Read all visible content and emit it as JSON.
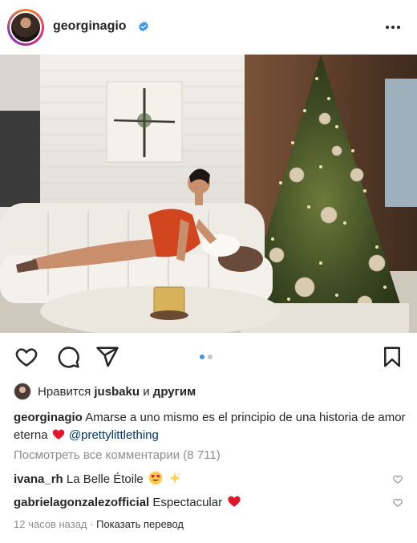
{
  "post": {
    "username": "georginagio",
    "verified_icon": "verified-badge-icon",
    "more_icon": "more-options-icon"
  },
  "actions": {
    "like_icon": "heart-outline-icon",
    "comment_icon": "comment-bubble-icon",
    "share_icon": "paper-plane-icon",
    "save_icon": "bookmark-icon",
    "carousel": {
      "total": 2,
      "active": 1
    }
  },
  "likes": {
    "prefix": "Нравится",
    "user": "jusbaku",
    "joiner": "и",
    "others": "другим"
  },
  "caption": {
    "username": "georginagio",
    "text": "Amarse a uno mismo es el principio de una historia de amor eterna",
    "emoji": "red-heart",
    "mention": "@prettylittlething"
  },
  "view_comments": "Посмотреть все комментарии (8 711)",
  "comments": [
    {
      "username": "ivana_rh",
      "text": "La Belle Étoile",
      "emojis": [
        "heart-eyes",
        "sparkle-star"
      ]
    },
    {
      "username": "gabrielagonzalezofficial",
      "text": "Espectacular",
      "emojis": [
        "red-heart"
      ]
    }
  ],
  "footer": {
    "time": "12 часов назад",
    "separator": "·",
    "translate": "Показать перевод"
  },
  "colors": {
    "accent_blue": "#3897f0",
    "link": "#00376b",
    "muted": "#8e8e8e",
    "text": "#262626",
    "heart_red": "#ed4956"
  }
}
